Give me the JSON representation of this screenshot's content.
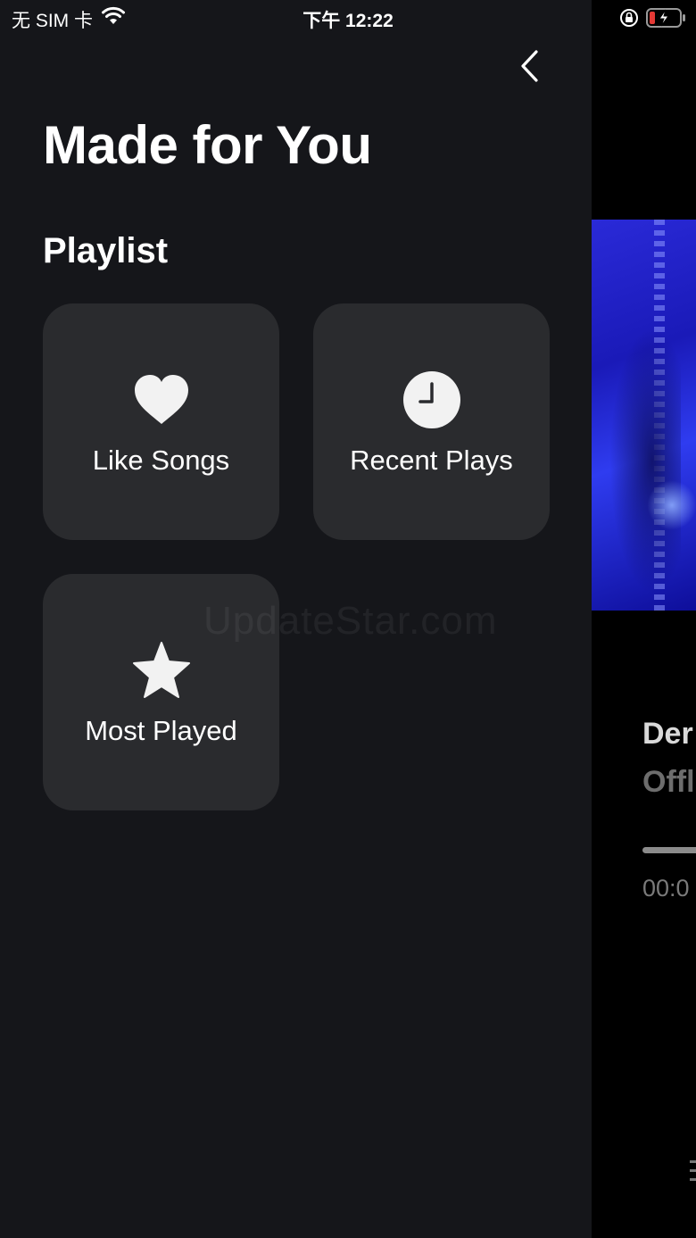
{
  "status_bar": {
    "carrier": "无 SIM 卡",
    "time": "下午 12:22"
  },
  "drawer": {
    "title": "Made for You",
    "section_title": "Playlist",
    "cards": [
      {
        "label": "Like Songs",
        "icon": "heart-icon"
      },
      {
        "label": "Recent Plays",
        "icon": "clock-icon"
      },
      {
        "label": "Most Played",
        "icon": "star-icon"
      }
    ]
  },
  "player": {
    "song_title": "Der",
    "artist": "Offl",
    "current_time": "00:0"
  },
  "watermark": "UpdateStar.com",
  "colors": {
    "drawer_bg": "#15161a",
    "card_bg": "#2a2b2e",
    "artwork_blue": "#2a2ad8"
  }
}
